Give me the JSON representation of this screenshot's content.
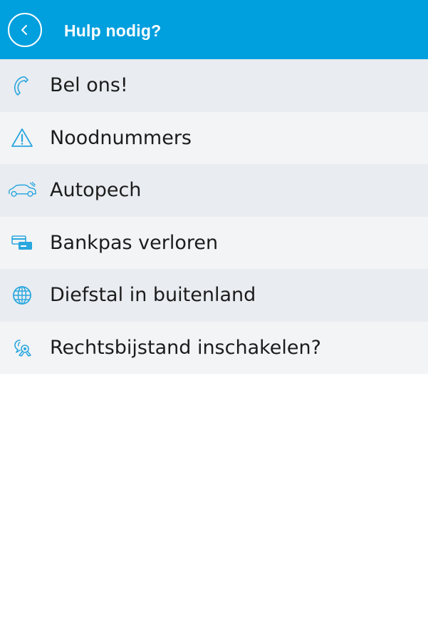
{
  "header": {
    "title": "Hulp nodig?",
    "back_icon": "chevron-left-icon",
    "background_color": "#009fde"
  },
  "menu": {
    "items": [
      {
        "label": "Bel ons!",
        "icon": "phone-icon"
      },
      {
        "label": "Noodnummers",
        "icon": "warning-triangle-icon"
      },
      {
        "label": "Autopech",
        "icon": "car-breakdown-icon"
      },
      {
        "label": "Bankpas verloren",
        "icon": "bank-card-icon"
      },
      {
        "label": "Diefstal in buitenland",
        "icon": "globe-icon"
      },
      {
        "label": "Rechtsbijstand inschakelen?",
        "icon": "legal-aid-icon"
      }
    ],
    "icon_color": "#2aa7df",
    "row_colors": [
      "#e9ecf0",
      "#f3f4f6"
    ]
  }
}
